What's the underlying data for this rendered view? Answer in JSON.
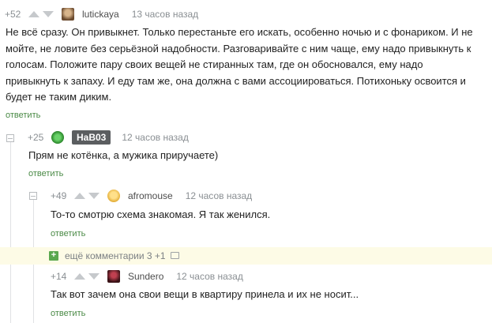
{
  "comments": [
    {
      "rating": "+52",
      "user": "lutickaya",
      "time": "13 часов назад",
      "avatar_color": "#7a5a3a",
      "lines": [
        "Не всё сразу. Он привыкнет. Только перестаньте его искать, особенно ночью и с фонариком. И не",
        "мойте, не ловите без серьёзной надобности. Разговаривайте с ним чаще, ему надо привыкнуть к",
        "голосам. Положите пару своих вещей не стиранных там, где он обосновался, ему надо",
        "привыкнуть к запаху. И еду там же, она должна с вами ассоциироваться. Потихоньку освоится и",
        "будет не таким диким."
      ],
      "reply": "ответить"
    },
    {
      "rating": "+25",
      "user": "НаВ03",
      "time": "12 часов назад",
      "avatar_color": "#3aa83a",
      "lines": [
        "Прям не котёнка, а мужика приручаете)"
      ],
      "reply": "ответить"
    },
    {
      "rating": "+49",
      "user": "afromouse",
      "time": "12 часов назад",
      "avatar_color": "#f2c94c",
      "lines": [
        "То-то смотрю схема знакомая. Я так женился."
      ],
      "reply": "ответить"
    },
    {
      "rating": "+14",
      "user": "Sundero",
      "time": "12 часов назад",
      "avatar_color": "#5a1e24",
      "lines": [
        "Так вот зачем она свои вещи в квартиру принела и их не носит..."
      ],
      "reply": "ответить"
    }
  ],
  "more_comments": {
    "icon": "plus-icon",
    "label": "ещё комментарии 3 +1"
  }
}
